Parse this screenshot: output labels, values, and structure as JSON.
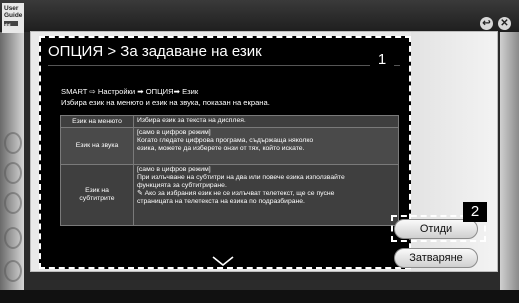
{
  "guide_logo": {
    "line1": "User",
    "line2": "Guide",
    "line3": "◀◀"
  },
  "top_buttons": [
    {
      "icon": "back-icon",
      "glyph": "↩"
    },
    {
      "icon": "close-icon",
      "glyph": "✕"
    }
  ],
  "popup": {
    "title": "ОПЦИЯ > За задаване на език",
    "breadcrumb": "SMART ⇨ Настройки ➡ ОПЦИЯ➡ Език",
    "description": "Избира език на менюто и език на звука, показан на екрана.",
    "options": [
      {
        "name": "Език на менюто",
        "text": [
          "Избира език за текста на дисплея."
        ]
      },
      {
        "name": "Език на звука",
        "text": [
          "[само в цифров режим]",
          "Когато гледате цифрова програма, съдържаща няколко",
          "езика, можете да изберете онзи от тях, който искате."
        ]
      },
      {
        "name": "Език на субтитрите",
        "text": [
          "[само в цифров режим]",
          "При излъчване на субтитри на два или повече езика използвайте",
          "функцията за субтитриране.",
          "✎ Ако за избрания език не се излъчват телетекст, ще се пусне",
          "   страницата на телетекста на езика по подразбиране."
        ]
      }
    ],
    "scroll_icon": "chevron-down-icon"
  },
  "buttons": {
    "go": "Отиди",
    "close": "Затваряне"
  },
  "badges": [
    "1",
    "2"
  ],
  "colors": {
    "content_bg": "#000000",
    "panel_bg": "#e9e9e9",
    "focus": "#ffffff"
  }
}
